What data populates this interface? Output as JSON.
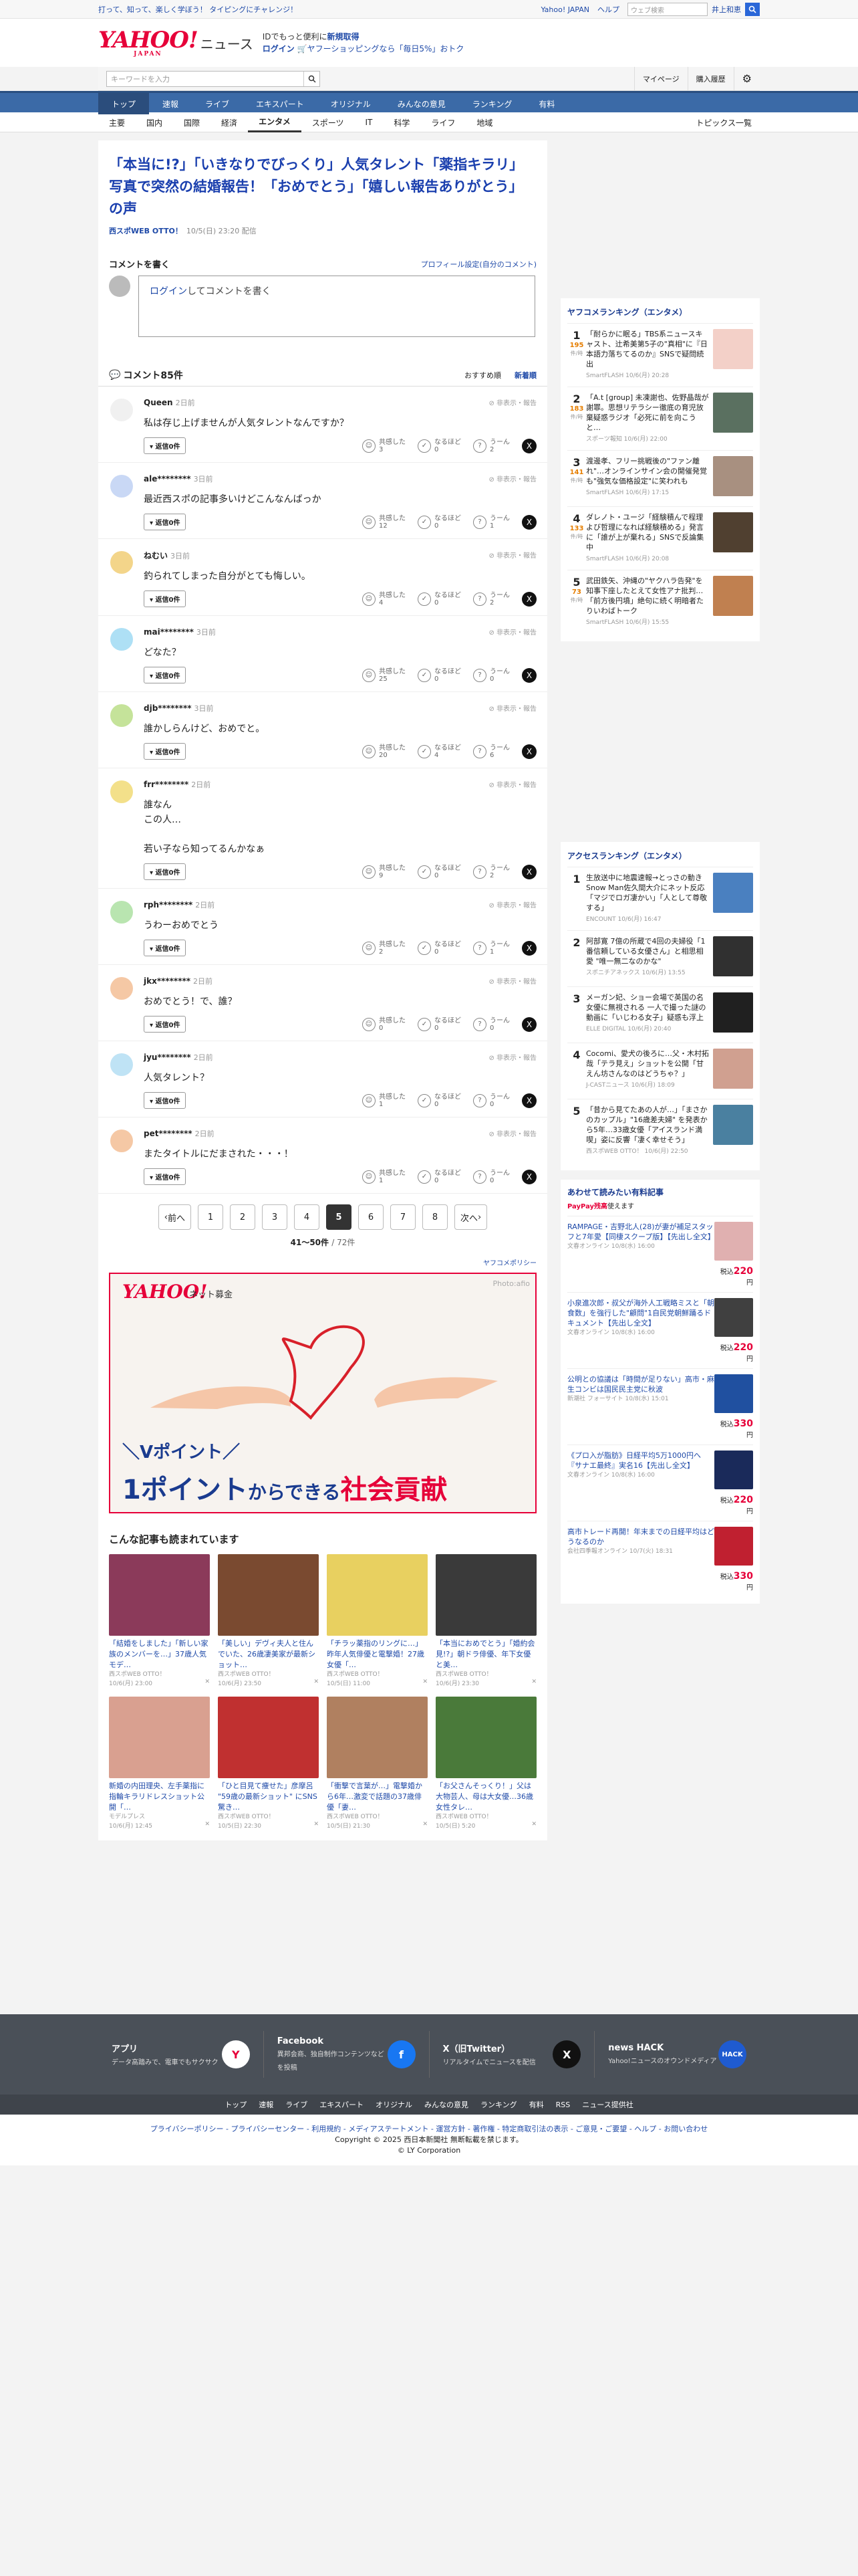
{
  "topbar": {
    "tagline": "打って、知って、楽しく学ぼう！ タイピングにチャレンジ！",
    "links": [
      "Yahoo! JAPAN",
      "ヘルプ"
    ],
    "search_placeholder": "ウェブ検索",
    "user": "井上和恵"
  },
  "header": {
    "logo": "YAHOO!",
    "logo_sub": "JAPAN",
    "logo_news": "ニュース",
    "promo_line1": "IDでもっと便利に",
    "promo_link": "新規取得",
    "promo_line2_link": "ログイン",
    "promo_line2": "ヤフーショッピングなら「毎日5%」おトク"
  },
  "search": {
    "placeholder": "キーワードを入力",
    "mypage": "マイページ",
    "history": "購入履歴"
  },
  "globalnav": [
    "トップ",
    "速報",
    "ライブ",
    "エキスパート",
    "オリジナル",
    "みんなの意見",
    "ランキング",
    "有料"
  ],
  "subnav": [
    "主要",
    "国内",
    "国際",
    "経済",
    "エンタメ",
    "スポーツ",
    "IT",
    "科学",
    "ライフ",
    "地域"
  ],
  "subnav_right": "トピックス一覧",
  "article": {
    "headline": "「本当に!?」「いきなりでびっくり」人気タレント「薬指キラリ」写真で突然の結婚報告！「おめでとう」「嬉しい報告ありがとう」の声",
    "source": "西スポWEB OTTO！",
    "date": "10/5(日) 23:20 配信"
  },
  "comment_form": {
    "title": "コメントを書く",
    "profile_link": "プロフィール設定(自分のコメント)",
    "login": "ログイン",
    "placeholder": "してコメントを書く"
  },
  "comments_header": {
    "title": "コメント85件",
    "sort_recommended": "おすすめ順",
    "sort_newest": "新着順"
  },
  "labels": {
    "flag": "非表示・報告",
    "reply": "返信0件",
    "r1": "共感した",
    "r2": "なるほど",
    "r3": "うーん"
  },
  "comments": [
    {
      "user": "Queen",
      "ago": "2日前",
      "text": "私は存じ上げませんが人気タレントなんですか？",
      "r1": "3",
      "r2": "0",
      "r3": "2",
      "color": "#f0f0f0"
    },
    {
      "user": "ale********",
      "ago": "3日前",
      "text": "最近西スポの記事多いけどこんなんばっか",
      "r1": "12",
      "r2": "0",
      "r3": "1",
      "color": "#c9d8f5"
    },
    {
      "user": "ねむい",
      "ago": "3日前",
      "text": "釣られてしまった自分がとても悔しい。",
      "r1": "4",
      "r2": "0",
      "r3": "2",
      "color": "#f3d58a"
    },
    {
      "user": "mai********",
      "ago": "3日前",
      "text": "どなた？",
      "r1": "25",
      "r2": "0",
      "r3": "0",
      "color": "#aee0f5"
    },
    {
      "user": "djb********",
      "ago": "3日前",
      "text": "誰かしらんけど、おめでと。",
      "r1": "20",
      "r2": "4",
      "r3": "6",
      "color": "#c5e39a"
    },
    {
      "user": "frr********",
      "ago": "2日前",
      "text": "誰なん\nこの人…\n\n若い子なら知ってるんかなぁ",
      "r1": "9",
      "r2": "0",
      "r3": "2",
      "color": "#f3e08a"
    },
    {
      "user": "rph********",
      "ago": "2日前",
      "text": "うわーおめでとう",
      "r1": "2",
      "r2": "0",
      "r3": "1",
      "color": "#b9e5b0"
    },
    {
      "user": "jkx********",
      "ago": "2日前",
      "text": "おめでとう！で、誰？",
      "r1": "0",
      "r2": "0",
      "r3": "0",
      "color": "#f5c8a5"
    },
    {
      "user": "jyu********",
      "ago": "2日前",
      "text": "人気タレント？",
      "r1": "1",
      "r2": "0",
      "r3": "0",
      "color": "#bfe3f5"
    },
    {
      "user": "pet********",
      "ago": "2日前",
      "text": "またタイトルにだまされた・・・！",
      "r1": "1",
      "r2": "0",
      "r3": "0",
      "color": "#f5c8a5"
    }
  ],
  "pager": {
    "prev": "前へ",
    "next": "次へ",
    "pages": [
      "1",
      "2",
      "3",
      "4",
      "5",
      "6",
      "7",
      "8"
    ],
    "current": "5",
    "count": "41〜50件",
    "total": "/ 72件"
  },
  "policy": "ヤフコメポリシー",
  "ad": {
    "logo": "YAHOO!",
    "sub": "ネット募金",
    "photo": "Photo:afio",
    "line1": "＼Vポイント／",
    "line2a": "1ポイント",
    "line2b": "からできる",
    "line2c": "社会貢献"
  },
  "recommend": {
    "title": "こんな記事も読まれています",
    "items": [
      {
        "title": "「結婚をしました」「新しい家族のメンバーを…」37歳人気モデ…",
        "src": "西スポWEB OTTO！",
        "time": "10/6(月) 23:00",
        "color": "#8b3a5a"
      },
      {
        "title": "「美しい」デヴィ夫人と住んでいた、26歳凄美家が最新ショット…",
        "src": "西スポWEB OTTO！",
        "time": "10/6(月) 23:50",
        "color": "#7a4a30"
      },
      {
        "title": "「チラッ薬指のリングに…」昨年人気俳優と電撃婚！27歳女優「…",
        "src": "西スポWEB OTTO！",
        "time": "10/5(日) 11:00",
        "color": "#e8d060"
      },
      {
        "title": "「本当におめでとう」「婚約会見!?」朝ドラ俳優、年下女優と美…",
        "src": "西スポWEB OTTO！",
        "time": "10/6(月) 23:30",
        "color": "#3a3a3a"
      },
      {
        "title": "新婚の内田理央、左手薬指に指輪キラリドレスショット公開「…",
        "src": "モデルプレス",
        "time": "10/6(月) 12:45",
        "color": "#d9a090"
      },
      {
        "title": "「ひと目見て痩せた」彦摩呂 \"59歳の最新ショット\" にSNS驚き…",
        "src": "西スポWEB OTTO！",
        "time": "10/5(日) 22:30",
        "color": "#c03030"
      },
      {
        "title": "「衝撃で言葉が…」電撃婚から6年…激変で話題の37歳俳優「妻…",
        "src": "西スポWEB OTTO！",
        "time": "10/5(日) 21:30",
        "color": "#b08060"
      },
      {
        "title": "「お父さんそっくり！」父は大物芸人、母は大女優…36歳女性タレ…",
        "src": "西スポWEB OTTO！",
        "time": "10/5(日) 5:20",
        "color": "#4a7a3a"
      }
    ]
  },
  "ranking1": {
    "title": "ヤフコメランキング（エンタメ）",
    "items": [
      {
        "rank": "1",
        "count": "195",
        "unit": "件/時",
        "title": "「耐らかに眠る」TBS系ニュースキャスト、辻希美第5子の\"真相\"に『日本語力落ちてるのか』SNSで疑問続出",
        "src": "SmartFLASH 10/6(月) 20:28",
        "color": "#f3d0c8"
      },
      {
        "rank": "2",
        "count": "183",
        "unit": "件/時",
        "title": "「A.t [group] 未凍謝也、佐野晶哉が謝罪。思想リテラシー徹底の育児放棄疑惑ラジオ「必死に前を向こうと…",
        "src": "スポーツ報知 10/6(月) 22:00",
        "color": "#5a7060"
      },
      {
        "rank": "3",
        "count": "141",
        "unit": "件/時",
        "title": "渡邊孝、フリー挑戦後の\"ファン離れ\"…オンラインサイン会の開催発覚も\"強気な価格設定\"に笑われも",
        "src": "SmartFLASH 10/6(月) 17:15",
        "color": "#a89080"
      },
      {
        "rank": "4",
        "count": "133",
        "unit": "件/時",
        "title": "ダレノト・ユージ「経験積んで程理よび哲理になれば経験積める」発言に「誰が上が棄れる」SNSで反論集中",
        "src": "SmartFLASH 10/6(月) 20:08",
        "color": "#504030"
      },
      {
        "rank": "5",
        "count": "73",
        "unit": "件/時",
        "title": "武田鉄矢、沖縄の\"ヤクハラ告発\"を知事下座したとえて女性アナ批判…「前方後円墳」絶句に続く明暗者たりいわばトーク",
        "src": "SmartFLASH 10/6(月) 15:55",
        "color": "#c08050"
      }
    ]
  },
  "ranking2": {
    "title": "アクセスランキング（エンタメ）",
    "items": [
      {
        "rank": "1",
        "title": "生放送中に地震速報→とっさの動き Snow Man佐久間大介にネット反応「マジでロガ凄かい」「人として尊敬する」",
        "src": "ENCOUNT 10/6(月) 16:47",
        "color": "#4a80c0"
      },
      {
        "rank": "2",
        "title": "阿部寛 7億の所蔵で4回の夫婦役「1番信頼している女優さん」と相思相愛 \"唯一無二なのかな\"",
        "src": "スポニチアネックス 10/6(月) 13:55",
        "color": "#303030"
      },
      {
        "rank": "3",
        "title": "メーガン妃、ショー会場で英国の名女優に無視される 一人で撮った謎の動画に「いじわる女子」疑惑も浮上",
        "src": "ELLE DIGITAL 10/6(月) 20:40",
        "color": "#202020"
      },
      {
        "rank": "4",
        "title": "Cocomi、愛犬の後ろに…父・木村拓哉「テラ見え」ショットを公開「甘えん坊さんなのはどうちゃ？」",
        "src": "J-CASTニュース 10/6(月) 18:09",
        "color": "#d0a090"
      },
      {
        "rank": "5",
        "title": "「昔から見てたあの人が…」「まさかのカップル」\"16歳差夫婦\" を発表から5年…33歳女優「アイスランド満喫」姿に反響「凄く幸せそう」",
        "src": "西スポWEB OTTO！ 10/6(月) 22:50",
        "color": "#4a80a0"
      }
    ]
  },
  "paid": {
    "title": "あわせて読みたい有料記事",
    "paypay": "PayPay残高",
    "paypay_rest": "使えます",
    "items": [
      {
        "title": "RAMPAGE・吉野北人(28)が妻が補足スタッフと7年愛【同棲スクープ版】【先出し全文】",
        "src": "文春オンライン 10/8(水) 16:00",
        "price_pre": "税込",
        "price": "220",
        "unit": "円",
        "color": "#e0b0b0"
      },
      {
        "title": "小泉進次郎・叔父が海外人工戦略ミスと「朝食数」を強行した\"顧問\"1自民党朝鮮踊るドキュメント【先出し全文】",
        "src": "文春オンライン 10/8(水) 16:00",
        "price_pre": "税込",
        "price": "220",
        "unit": "円",
        "color": "#404040"
      },
      {
        "title": "公明との協議は「時間が足りない」高市・麻生コンビは国民民主党に秋波",
        "src": "新潮社 フォーサイト 10/8(水) 15:01",
        "price_pre": "税込",
        "price": "330",
        "unit": "円",
        "color": "#2050a0"
      },
      {
        "title": "《プロ入が脂肪》日経平均5万1000円へ『サナエ最終』実名16【先出し全文】",
        "src": "文春オンライン 10/8(水) 16:00",
        "price_pre": "税込",
        "price": "220",
        "unit": "円",
        "color": "#1a2a5a"
      },
      {
        "title": "高市トレード再開！年末までの日経平均はどうなるのか",
        "src": "会社四季報オンライン 10/7(火) 18:31",
        "price_pre": "税込",
        "price": "330",
        "unit": "円",
        "color": "#c02030"
      }
    ]
  },
  "footer": {
    "cards": [
      {
        "title": "アプリ",
        "desc": "データ高踏みで、電車でもサクサク",
        "icon": "Y",
        "color": "#ffffff",
        "fg": "#e60039"
      },
      {
        "title": "Facebook",
        "desc": "異邦会商、独自制作コンテンツなどを投稿",
        "icon": "f",
        "color": "#1877f2",
        "fg": "#ffffff"
      },
      {
        "title": "X（旧Twitter）",
        "desc": "リアルタイムでニュースを配信",
        "icon": "X",
        "color": "#111111",
        "fg": "#ffffff"
      },
      {
        "title": "news HACK",
        "desc": "Yahoo!ニュースのオウンドメディア",
        "icon": "HACK",
        "color": "#1f5bd0",
        "fg": "#ffffff"
      }
    ],
    "nav": [
      "トップ",
      "速報",
      "ライブ",
      "エキスパート",
      "オリジナル",
      "みんなの意見",
      "ランキング",
      "有料",
      "RSS",
      "ニュース提供社"
    ],
    "legal_links": "プライバシーポリシー - プライバシーセンター - 利用規約 - メディアステートメント - 運営方針 - 著作権 - 特定商取引法の表示 - ご意見・ご要望 - ヘルプ - お問い合わせ",
    "copyright1": "Copyright © 2025 西日本新聞社 無断転載を禁じます。",
    "copyright2": "© LY Corporation"
  }
}
